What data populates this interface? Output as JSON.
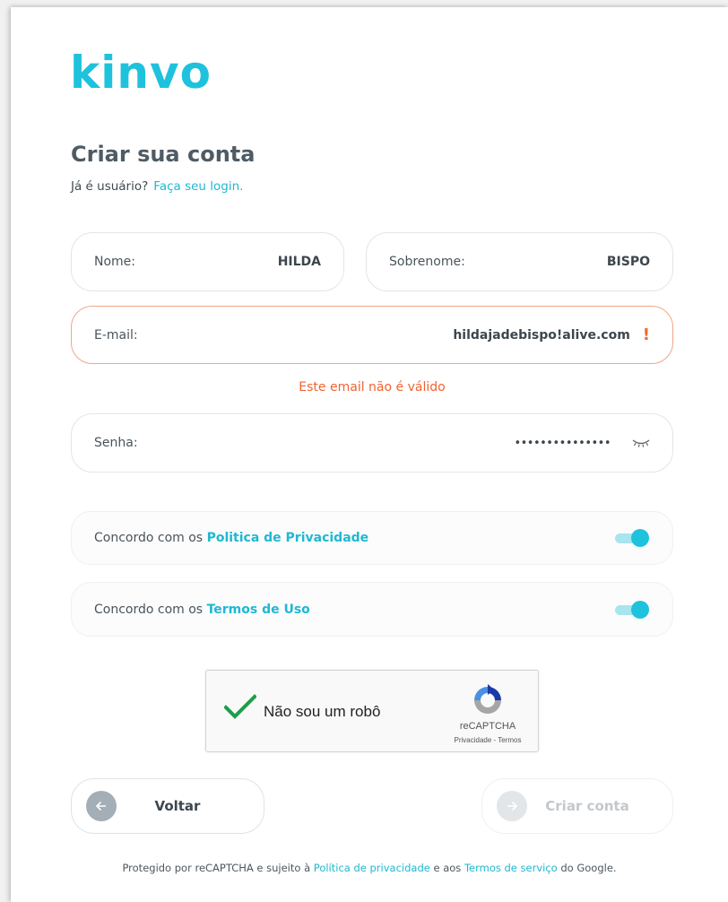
{
  "brand": {
    "logo_text": "kinvo",
    "accent_color": "#1fc2dc"
  },
  "header": {
    "title": "Criar sua conta",
    "login_prompt": "Já é usuário?",
    "login_link": "Faça seu login."
  },
  "form": {
    "first_name": {
      "label": "Nome:",
      "value": "HILDA"
    },
    "last_name": {
      "label": "Sobrenome:",
      "value": "BISPO"
    },
    "email": {
      "label": "E-mail:",
      "value": "hildajadebispo!alive.com",
      "error_mark": "!",
      "error_message": "Este email não é válido",
      "error_color": "#f06330"
    },
    "password": {
      "label": "Senha:",
      "value": "•••••••••••••••",
      "icon": "eye-closed-icon"
    }
  },
  "consents": {
    "privacy": {
      "prefix": "Concordo com os",
      "link": "Politica de Privacidade",
      "enabled": true
    },
    "terms": {
      "prefix": "Concordo com os",
      "link": "Termos de Uso",
      "enabled": true
    }
  },
  "captcha": {
    "label": "Não sou um robô",
    "brand": "reCAPTCHA",
    "privacy": "Privacidade",
    "separator": "-",
    "terms": "Termos",
    "checked": true
  },
  "actions": {
    "back_label": "Voltar",
    "back_icon": "arrow-left-icon",
    "create_label": "Criar conta",
    "create_icon": "arrow-right-icon"
  },
  "footer": {
    "text_start": "Protegido por reCAPTCHA e sujeito à",
    "privacy_link": "Política de privacidade",
    "text_mid": "e aos",
    "terms_link": "Termos de serviço",
    "text_end": "do Google."
  }
}
